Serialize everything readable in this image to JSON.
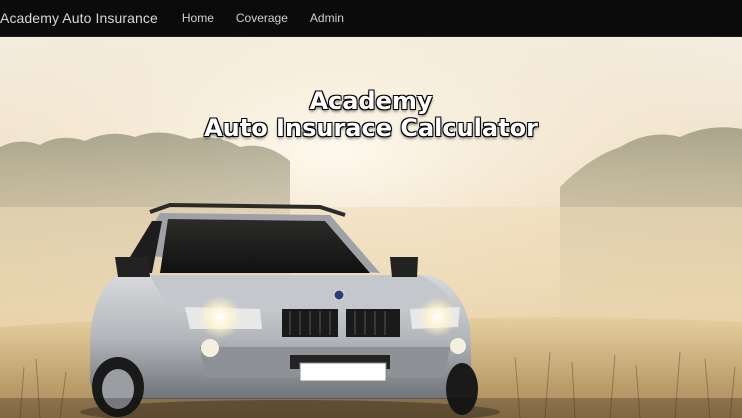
{
  "navbar": {
    "brand": "Academy Auto Insurance",
    "links": [
      {
        "label": "Home"
      },
      {
        "label": "Coverage"
      },
      {
        "label": "Admin"
      }
    ]
  },
  "hero": {
    "title_line1": "Academy",
    "title_line2": "Auto Insurace Calculator",
    "image_icon": "car-in-foggy-field-photo"
  },
  "colors": {
    "navbar_bg": "#0b0b0b",
    "nav_text": "#d0d0d0",
    "title_text": "#ffffff",
    "fog_light": "#f4ede1",
    "fog_warm": "#e7cfa6",
    "car_silver": "#b9bcc0"
  }
}
